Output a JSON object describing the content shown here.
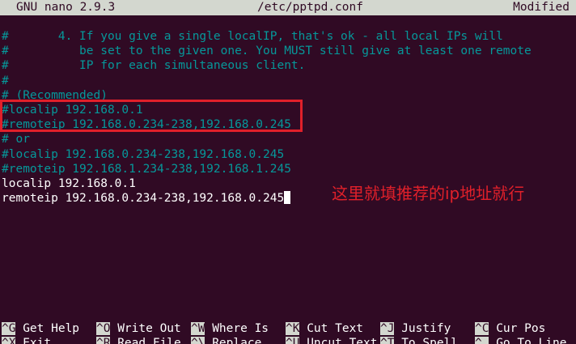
{
  "titlebar": {
    "app": "GNU nano 2.9.3",
    "file": "/etc/pptpd.conf",
    "status": "Modified"
  },
  "lines": [
    {
      "text": "#       4. If you give a single localIP, that's ok - all local IPs will",
      "style": "comment"
    },
    {
      "text": "#          be set to the given one. You MUST still give at least one remote",
      "style": "comment"
    },
    {
      "text": "#          IP for each simultaneous client.",
      "style": "comment"
    },
    {
      "text": "#",
      "style": "comment"
    },
    {
      "text": "# (Recommended)",
      "style": "comment"
    },
    {
      "text": "#localip 192.168.0.1",
      "style": "comment"
    },
    {
      "text": "#remoteip 192.168.0.234-238,192.168.0.245",
      "style": "comment"
    },
    {
      "text": "# or",
      "style": "comment"
    },
    {
      "text": "#localip 192.168.0.234-238,192.168.0.245",
      "style": "comment"
    },
    {
      "text": "#remoteip 192.168.1.234-238,192.168.1.245",
      "style": "comment"
    },
    {
      "text": "localip 192.168.0.1",
      "style": "code"
    },
    {
      "text": "remoteip 192.168.0.234-238,192.168.0.245",
      "style": "code"
    }
  ],
  "annotation": "这里就填推荐的ip地址就行",
  "shortcuts": {
    "row1": [
      {
        "key": "^G",
        "label": " Get Help"
      },
      {
        "key": "^O",
        "label": " Write Out"
      },
      {
        "key": "^W",
        "label": " Where Is"
      },
      {
        "key": "^K",
        "label": " Cut Text"
      },
      {
        "key": "^J",
        "label": " Justify"
      },
      {
        "key": "^C",
        "label": " Cur Pos"
      }
    ],
    "row2": [
      {
        "key": "^X",
        "label": " Exit"
      },
      {
        "key": "^R",
        "label": " Read File"
      },
      {
        "key": "^\\",
        "label": " Replace"
      },
      {
        "key": "^U",
        "label": " Uncut Text"
      },
      {
        "key": "^T",
        "label": " To Spell"
      },
      {
        "key": "^_",
        "label": " Go To Line"
      }
    ]
  },
  "colors": {
    "background": "#300a24",
    "comment": "#06989a",
    "annotation": "#e0202a",
    "bar": "#d3d7cf"
  }
}
